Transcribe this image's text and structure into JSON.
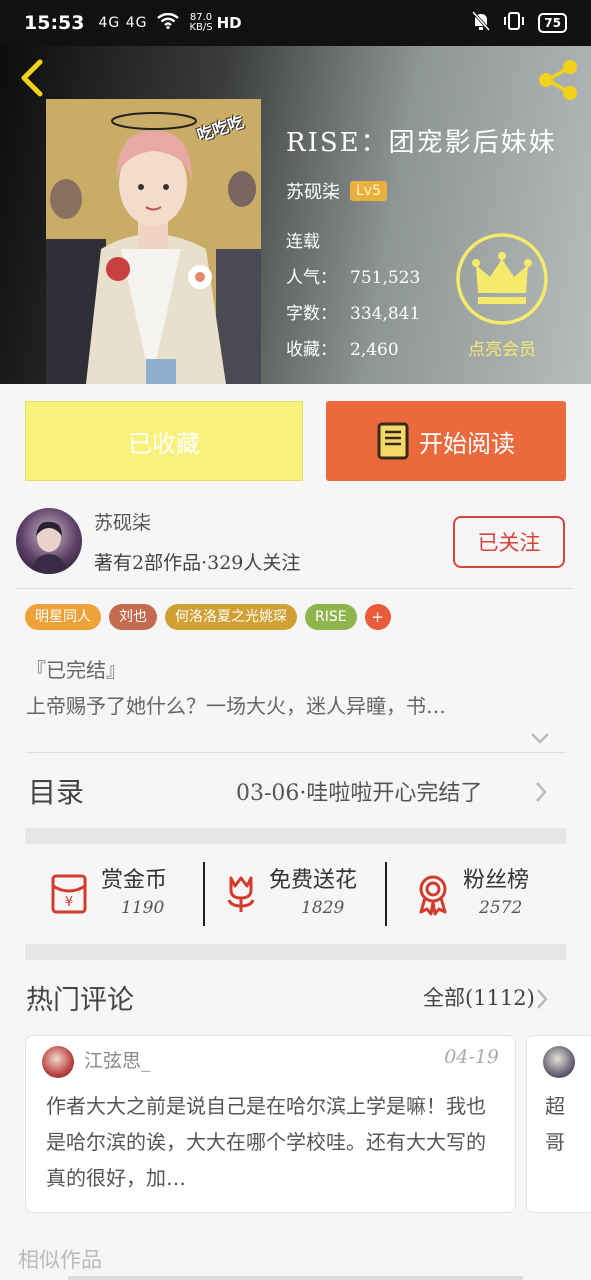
{
  "status_bar": {
    "time": "15:53",
    "signal": "4G 4G",
    "net_speed": "87.0",
    "net_unit": "KB/S",
    "hd": "HD",
    "battery": "75"
  },
  "book": {
    "title": "RISE：团宠影后妹妹",
    "author": "苏砚柒",
    "level": "Lv5",
    "status": "连载",
    "popularity_label": "人气：",
    "popularity": "751,523",
    "words_label": "字数：",
    "words": "334,841",
    "favorites_label": "收藏：",
    "favorites": "2,460",
    "vip_label": "点亮会员",
    "cover_sticker": "吃吃吃"
  },
  "actions": {
    "collected_label": "已收藏",
    "read_label": "开始阅读"
  },
  "author_card": {
    "name": "苏砚柒",
    "info": "著有2部作品·329人关注",
    "follow_label": "已关注"
  },
  "tags": [
    {
      "label": "明星同人",
      "color": "#f0a23a"
    },
    {
      "label": "刘也",
      "color": "#c46a4e"
    },
    {
      "label": "何洛洛夏之光姚琛",
      "color": "#d1a035"
    },
    {
      "label": "RISE",
      "color": "#8fb44e"
    }
  ],
  "tag_add": "+",
  "description": {
    "line1": "『已完结』",
    "line2": "上帝赐予了她什么？一场大火，迷人异瞳，书…"
  },
  "catalog": {
    "label": "目录",
    "latest": "03-06·哇啦啦开心完结了"
  },
  "stats": [
    {
      "label": "赏金币",
      "value": "1190",
      "icon": "red-envelope-icon"
    },
    {
      "label": "免费送花",
      "value": "1829",
      "icon": "flower-icon"
    },
    {
      "label": "粉丝榜",
      "value": "2572",
      "icon": "medal-icon"
    }
  ],
  "comments": {
    "title": "热门评论",
    "all_label": "全部(1112)",
    "items": [
      {
        "user": "江弦思_",
        "date": "04-19",
        "text": "作者大大之前是说自己是在哈尔滨上学是嘛！我也是哈尔滨的诶，大大在哪个学校哇。还有大大写的真的很好，加…"
      },
      {
        "user": "",
        "date": "",
        "text": "超哥"
      }
    ]
  },
  "similar_label": "相似作品",
  "colors": {
    "accent_orange": "#ea6a3e",
    "collected_yellow": "#f8f27a",
    "follow_red": "#d9443a",
    "vip_yellow": "#f6ea6c"
  }
}
